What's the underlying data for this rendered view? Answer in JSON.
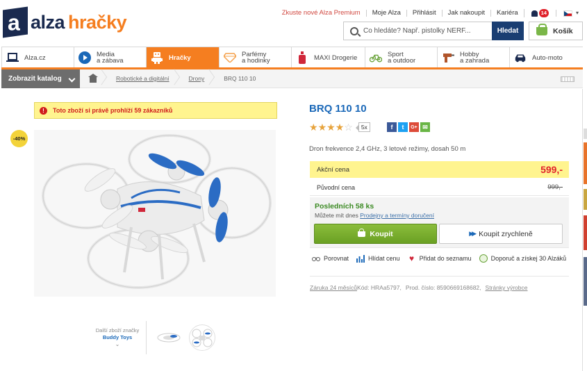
{
  "brand": {
    "alza": "alza",
    "hracky": "hračky",
    "logo_letter": "a"
  },
  "colors": {
    "orange": "#f57e20",
    "navy": "#1a2a4f",
    "blue": "#1a68b8",
    "green": "#6aa023",
    "red": "#e0212a",
    "yellow": "#fff48f"
  },
  "toplinks": [
    "Zkuste nové Alza Premium",
    "Moje Alza",
    "Přihlásit",
    "Jak nakoupit",
    "Kariéra"
  ],
  "notifications": {
    "count": "14"
  },
  "search": {
    "placeholder": "Co hledáte? Např. pistolky NERF...",
    "button": "Hledat"
  },
  "cart": {
    "label": "Košík"
  },
  "categories": [
    {
      "l1": "Alza.cz",
      "l2": "",
      "icon": "laptop-icon"
    },
    {
      "l1": "Media",
      "l2": "a zábava",
      "icon": "play-icon"
    },
    {
      "l1": "Hračky",
      "l2": "",
      "icon": "robot-icon"
    },
    {
      "l1": "Parfémy",
      "l2": "a hodinky",
      "icon": "diamond-icon"
    },
    {
      "l1": "MAXI Drogerie",
      "l2": "",
      "icon": "bottle-icon"
    },
    {
      "l1": "Sport",
      "l2": "a outdoor",
      "icon": "bicycle-icon"
    },
    {
      "l1": "Hobby",
      "l2": "a zahrada",
      "icon": "drill-icon"
    },
    {
      "l1": "Auto-moto",
      "l2": "",
      "icon": "car-icon"
    }
  ],
  "breadcrumb": {
    "catalog": "Zobrazit katalog",
    "items": [
      "Robotické a digitální",
      "Drony",
      "BRQ 110 10"
    ]
  },
  "notice": "Toto zboží si právě prohlíží 59 zákazníků",
  "discount": "-40%",
  "thumbs": {
    "label": "Další zboží značky",
    "brand": "Buddy Toys",
    "chevron": "⌄"
  },
  "product": {
    "title": "BRQ 110 10",
    "rating": {
      "value": 4,
      "count": "5x"
    },
    "description": "Dron frekvence 2,4 GHz, 3 letové režimy, dosah 50 m",
    "sale_label": "Akční cena",
    "sale_price": "599,-",
    "orig_label": "Původní cena",
    "orig_price": "999,-",
    "stock": "Posledních 58 ks",
    "avail_text": "Můžete mít dnes",
    "avail_link": "Prodejny a termíny doručení",
    "buy": "Koupit",
    "quick_buy": "Koupit zrychleně"
  },
  "actions": [
    "Porovnat",
    "Hlídat cenu",
    "Přidat do seznamu",
    "Doporuč a získej 30 Alzáků"
  ],
  "meta": {
    "warranty": "Záruka 24 měsíců",
    "code": "Kód: HRAa5797,",
    "part": "Prod. číslo: 8590669168682,",
    "maker": "Stránky výrobce"
  }
}
